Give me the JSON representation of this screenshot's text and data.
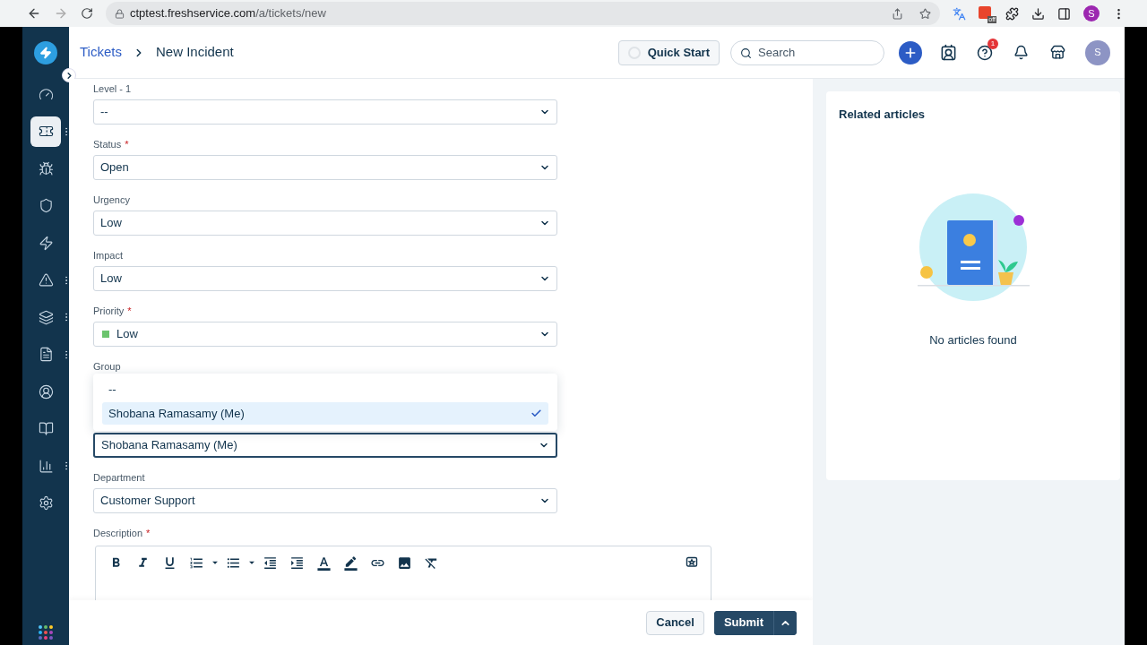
{
  "browser": {
    "url_domain": "ctptest.freshservice.com",
    "url_path": "/a/tickets/new",
    "extension_badge": "off",
    "profile_initial": "S"
  },
  "header": {
    "breadcrumb": [
      {
        "label": "Tickets",
        "link": true
      },
      {
        "label": "New Incident",
        "link": false
      }
    ],
    "quick_start": "Quick Start",
    "search": {
      "placeholder": "Search"
    },
    "help_badge": "1",
    "avatar": "S"
  },
  "sidebar": {
    "items": [
      {
        "selected": false,
        "menu": false
      },
      {
        "selected": true,
        "menu": true
      },
      {
        "selected": false,
        "menu": false
      },
      {
        "selected": false,
        "menu": false
      },
      {
        "selected": false,
        "menu": false
      },
      {
        "selected": false,
        "menu": true
      },
      {
        "selected": false,
        "menu": true
      },
      {
        "selected": false,
        "menu": true
      },
      {
        "selected": false,
        "menu": false
      },
      {
        "selected": false,
        "menu": false
      },
      {
        "selected": false,
        "menu": true
      },
      {
        "selected": false,
        "menu": false
      }
    ]
  },
  "form": {
    "fields": [
      {
        "label": "Level - 1",
        "value": "--",
        "focused": false
      },
      {
        "label": "Status",
        "required_mark": "*",
        "value": "Open",
        "focused": false
      },
      {
        "label": "Urgency",
        "value": "Low",
        "focused": false
      },
      {
        "label": "Impact",
        "value": "Low",
        "focused": false
      },
      {
        "label": "Priority",
        "required_mark": "*",
        "value": "Low",
        "color": "#6bc46d",
        "focused": false
      },
      {
        "label": "Group"
      },
      {
        "value": "Shobana Ramasamy (Me)",
        "focused": true
      },
      {
        "label": "Department",
        "value": "Customer Support",
        "focused": false
      }
    ],
    "dropdown": {
      "options": [
        {
          "label": "--",
          "selected": false
        },
        {
          "label": "Shobana Ramasamy (Me)",
          "selected": true
        }
      ]
    },
    "description": {
      "label": "Description",
      "required_mark": "*"
    }
  },
  "footer": {
    "buttons": [
      {
        "label": "Cancel",
        "kind": "secondary"
      },
      {
        "label": "Submit",
        "kind": "primary"
      }
    ]
  },
  "related": {
    "title": "Related articles",
    "empty_text": "No articles found"
  }
}
